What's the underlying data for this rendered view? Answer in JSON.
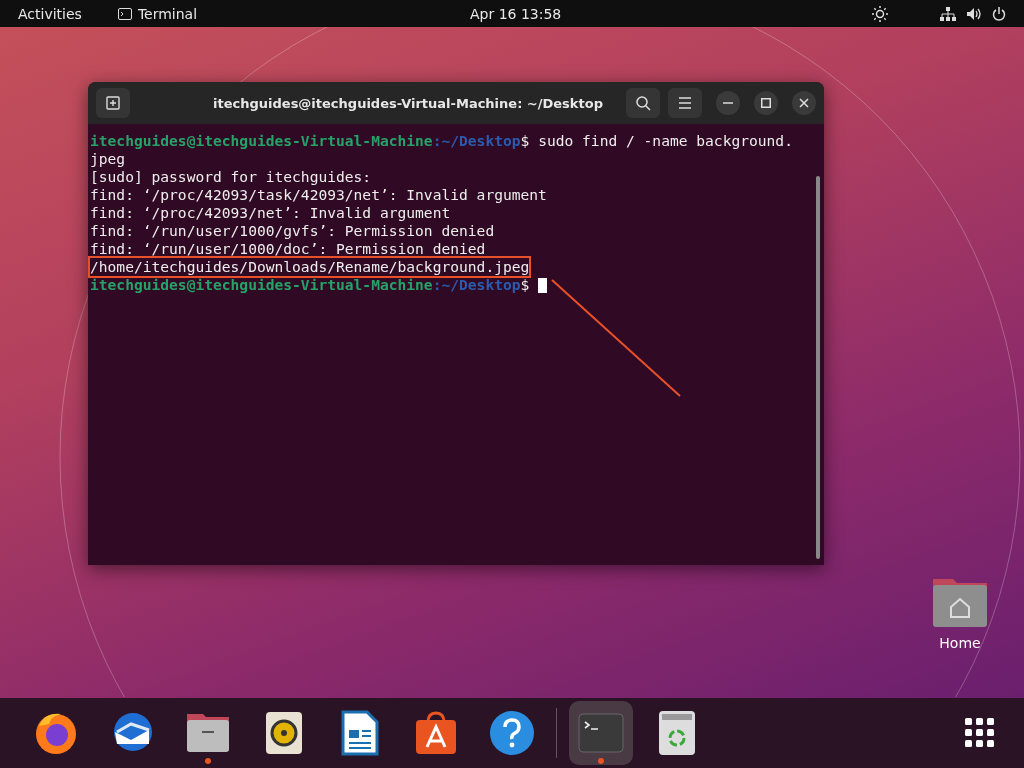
{
  "top_bar": {
    "activities": "Activities",
    "app_name": "Terminal",
    "clock": "Apr 16  13:58"
  },
  "terminal": {
    "title": "itechguides@itechguides-Virtual-Machine: ~/Desktop",
    "lines": [
      {
        "kind": "prompt",
        "user_host": "itechguides@itechguides-Virtual-Machine",
        "path": ":~/Desktop",
        "dollar": "$",
        "command": "sudo find / -name background.",
        "highlighted": false,
        "cursor": false
      },
      {
        "kind": "output",
        "text": "jpeg",
        "highlighted": false
      },
      {
        "kind": "output",
        "text": "[sudo] password for itechguides:",
        "highlighted": false
      },
      {
        "kind": "output",
        "text": "find: ‘/proc/42093/task/42093/net’: Invalid argument",
        "highlighted": false
      },
      {
        "kind": "output",
        "text": "find: ‘/proc/42093/net’: Invalid argument",
        "highlighted": false
      },
      {
        "kind": "output",
        "text": "find: ‘/run/user/1000/gvfs’: Permission denied",
        "highlighted": false
      },
      {
        "kind": "output",
        "text": "find: ‘/run/user/1000/doc’: Permission denied",
        "highlighted": false
      },
      {
        "kind": "output",
        "text": "/home/itechguides/Downloads/Rename/background.jpeg",
        "highlighted": true
      },
      {
        "kind": "prompt",
        "user_host": "itechguides@itechguides-Virtual-Machine",
        "path": ":~/Desktop",
        "dollar": "$",
        "highlighted": false,
        "cursor": true
      }
    ]
  },
  "desktop_icons": [
    {
      "label": "Home"
    }
  ],
  "dock": [
    {
      "kind": "firefox",
      "running": false,
      "selected": false
    },
    {
      "kind": "thunderbird",
      "running": false,
      "selected": false
    },
    {
      "kind": "files",
      "running": true,
      "selected": false
    },
    {
      "kind": "rhythmbox",
      "running": false,
      "selected": false
    },
    {
      "kind": "writer",
      "running": false,
      "selected": false
    },
    {
      "kind": "software",
      "running": false,
      "selected": false
    },
    {
      "kind": "help",
      "running": false,
      "selected": false
    },
    {
      "kind": "terminal",
      "running": true,
      "selected": true
    },
    {
      "kind": "trash",
      "running": false,
      "selected": false
    }
  ]
}
